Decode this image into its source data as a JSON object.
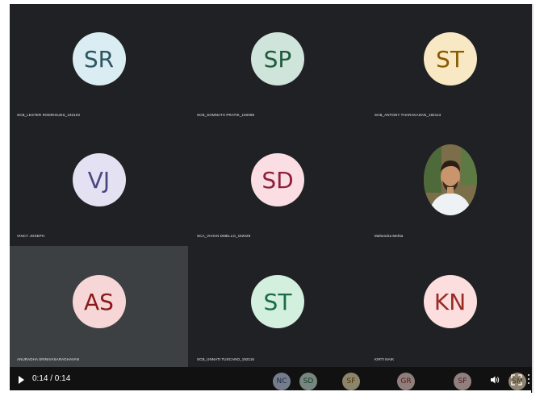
{
  "participants": [
    {
      "initials": "SR",
      "name": "SCB_LESTER RODRIGUES_192103",
      "avatar_bg": "#d9edf2",
      "avatar_fg": "#2c5462"
    },
    {
      "initials": "SP",
      "name": "SCB_SOMNATH PRATIK_192095",
      "avatar_bg": "#cfe4da",
      "avatar_fg": "#1e5a3c"
    },
    {
      "initials": "ST",
      "name": "SCB_ANTONY THARAKADAN_192113",
      "avatar_bg": "#f8e9c4",
      "avatar_fg": "#8a5a00"
    },
    {
      "initials": "VJ",
      "name": "VINCY JOSEPH",
      "avatar_bg": "#e4e2f2",
      "avatar_fg": "#4a4780"
    },
    {
      "initials": "SD",
      "name": "SCA_VIVIAN DMELLO_192029",
      "avatar_bg": "#fbdde4",
      "avatar_fg": "#8e2039"
    },
    {
      "initials": "",
      "name": "Mahendra Mehta",
      "avatar_bg": "#8a7a52",
      "avatar_fg": "#ffffff"
    },
    {
      "initials": "AS",
      "name": "ANURADHA SRINIVASARAGHAVAN",
      "avatar_bg": "#f6d6d6",
      "avatar_fg": "#8a1a1a"
    },
    {
      "initials": "ST",
      "name": "SCB_UNNATI TUSCANO_192116",
      "avatar_bg": "#d3efde",
      "avatar_fg": "#1b6b45"
    },
    {
      "initials": "KN",
      "name": "KIRTI NAIK",
      "avatar_bg": "#fbdedd",
      "avatar_fg": "#9c2a25"
    }
  ],
  "player": {
    "time": "0:14 / 0:14",
    "progress": 1.0
  },
  "strip": [
    {
      "initials": "NC",
      "bg": "#c8d6f2",
      "fg": "#2d3f7a"
    },
    {
      "initials": "SD",
      "bg": "#cbe8d9",
      "fg": "#1c5a3a"
    },
    {
      "initials": "SF",
      "bg": "#f3e2b8",
      "fg": "#7a5400"
    },
    {
      "initials": "GR",
      "bg": "#f6d8d4",
      "fg": "#8a2a22"
    },
    {
      "initials": "SF",
      "bg": "#f8d9d9",
      "fg": "#8c2020"
    },
    {
      "initials": "SM",
      "bg": "#f3e3c6",
      "fg": "#7a5a20"
    }
  ]
}
